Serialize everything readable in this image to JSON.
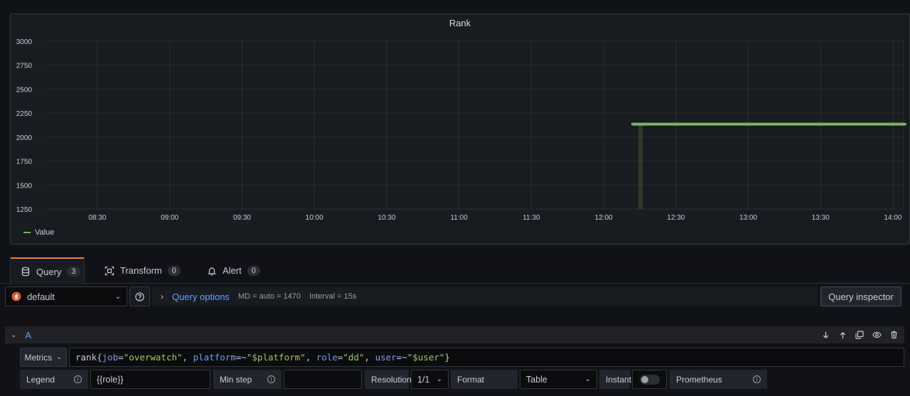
{
  "panel": {
    "title": "Rank",
    "legend_label": "Value"
  },
  "chart_data": {
    "type": "line",
    "title": "Rank",
    "ylim": [
      1250,
      3000
    ],
    "y_ticks": [
      "3000",
      "2750",
      "2500",
      "2250",
      "2000",
      "1750",
      "1500",
      "1250"
    ],
    "x_ticks": [
      "08:30",
      "09:00",
      "09:30",
      "10:00",
      "10:30",
      "11:00",
      "11:30",
      "12:00",
      "12:30",
      "13:00",
      "13:30",
      "14:00"
    ],
    "grid": true,
    "legend": "bottom-left",
    "series": [
      {
        "name": "Value",
        "color": "#7eb26d",
        "points": [
          {
            "x": "12:12",
            "y": 2135
          },
          {
            "x": "14:05",
            "y": 2135
          }
        ]
      }
    ]
  },
  "tabs": [
    {
      "label": "Query",
      "count": "3",
      "icon": "database-icon",
      "active": true
    },
    {
      "label": "Transform",
      "count": "0",
      "icon": "transform-icon",
      "active": false
    },
    {
      "label": "Alert",
      "count": "0",
      "icon": "bell-icon",
      "active": false
    }
  ],
  "datasource": {
    "selected": "default",
    "icon": "prometheus-icon"
  },
  "query_options": {
    "label": "Query options",
    "md": "MD = auto = 1470",
    "interval": "Interval = 15s"
  },
  "query_inspector_label": "Query inspector",
  "query_row": {
    "ref_id": "A",
    "metrics_label": "Metrics",
    "expr_tokens": [
      {
        "t": "rank",
        "c": "tok-fn"
      },
      {
        "t": "{",
        "c": "tok-p"
      },
      {
        "t": "job",
        "c": "tok-lbl"
      },
      {
        "t": "=",
        "c": "tok-op"
      },
      {
        "t": "\"overwatch\"",
        "c": "tok-str"
      },
      {
        "t": ", ",
        "c": "tok-p"
      },
      {
        "t": "platform",
        "c": "tok-lbl"
      },
      {
        "t": "=~",
        "c": "tok-op"
      },
      {
        "t": "\"$platform\"",
        "c": "tok-str"
      },
      {
        "t": ", ",
        "c": "tok-p"
      },
      {
        "t": "role",
        "c": "tok-lbl"
      },
      {
        "t": "=",
        "c": "tok-op"
      },
      {
        "t": "\"dd\"",
        "c": "tok-str"
      },
      {
        "t": ", ",
        "c": "tok-p"
      },
      {
        "t": "user",
        "c": "tok-lbl"
      },
      {
        "t": "=~",
        "c": "tok-op"
      },
      {
        "t": "\"$user\"",
        "c": "tok-str"
      },
      {
        "t": "}",
        "c": "tok-p"
      }
    ],
    "legend_label": "Legend",
    "legend_value": "{{role}}",
    "min_step_label": "Min step",
    "min_step_value": "",
    "resolution_label": "Resolution",
    "resolution_value": "1/1",
    "format_label": "Format",
    "format_value": "Table",
    "instant_label": "Instant",
    "prometheus_label": "Prometheus"
  }
}
